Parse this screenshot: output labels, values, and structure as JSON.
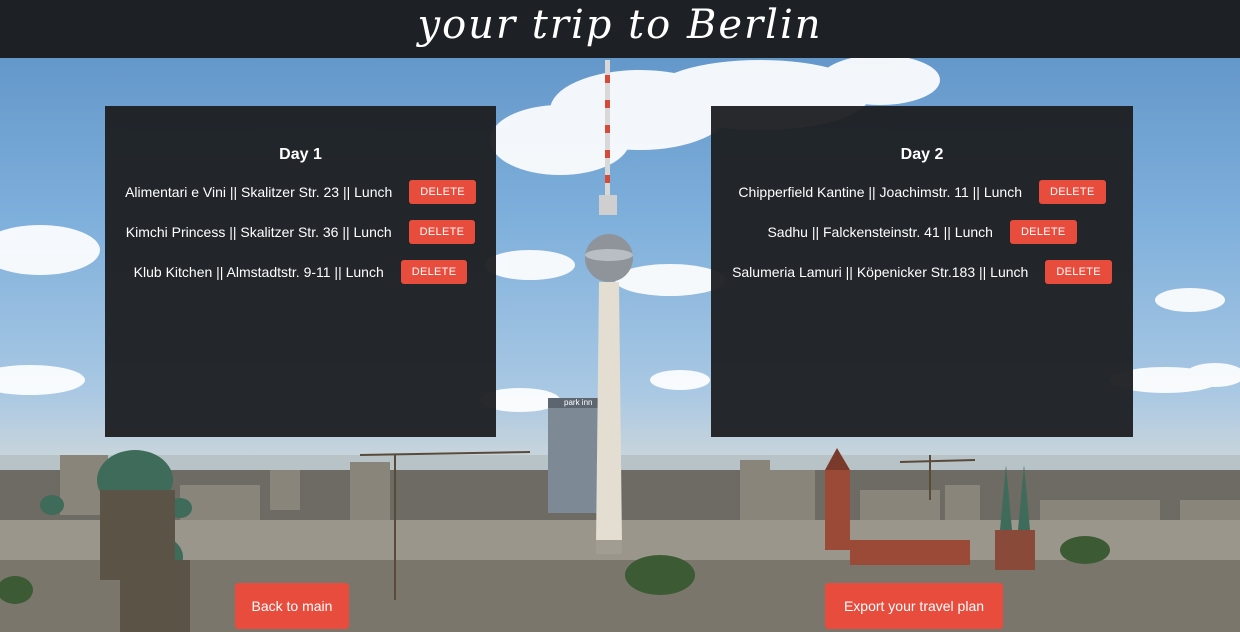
{
  "header": {
    "title": "your trip to Berlin"
  },
  "days": [
    {
      "title": "Day 1",
      "items": [
        {
          "text": "Alimentari e Vini || Skalitzer Str. 23 || Lunch",
          "delete_label": "DELETE"
        },
        {
          "text": "Kimchi Princess || Skalitzer Str. 36 || Lunch",
          "delete_label": "DELETE"
        },
        {
          "text": "Klub Kitchen || Almstadtstr. 9-11 || Lunch",
          "delete_label": "DELETE"
        }
      ]
    },
    {
      "title": "Day 2",
      "items": [
        {
          "text": "Chipperfield Kantine || Joachimstr. 11 || Lunch",
          "delete_label": "DELETE"
        },
        {
          "text": "Sadhu || Falckensteinstr. 41 || Lunch",
          "delete_label": "DELETE"
        },
        {
          "text": "Salumeria Lamuri || Köpenicker Str.183 || Lunch",
          "delete_label": "DELETE"
        }
      ]
    }
  ],
  "actions": {
    "back_label": "Back to main",
    "export_label": "Export your travel plan"
  },
  "colors": {
    "header_bg": "#1d2024",
    "panel_bg": "#1e2023",
    "accent": "#e84c3d"
  },
  "background": {
    "hotel_sign": "park inn"
  }
}
